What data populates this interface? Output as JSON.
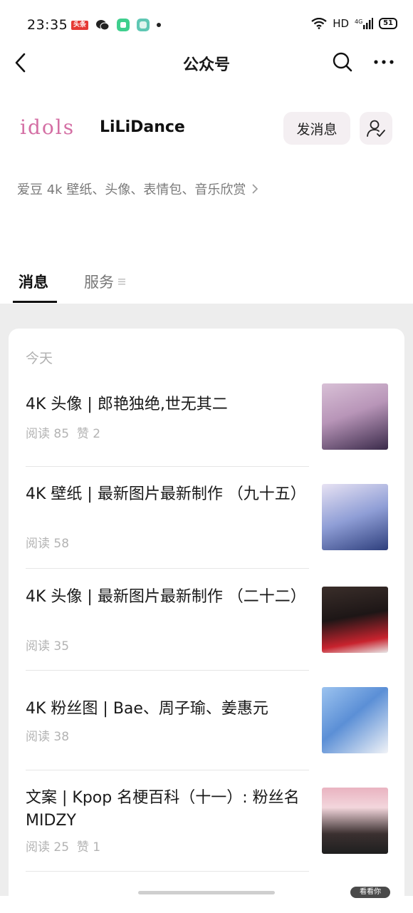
{
  "status_bar": {
    "time": "23:35",
    "toutiao_badge": "头条",
    "network": "HD",
    "signal_label": "4G",
    "battery": "51"
  },
  "nav": {
    "title": "公众号"
  },
  "account": {
    "logo_text": "idols",
    "name": "LiLiDance",
    "message_button": "发消息",
    "description": "爱豆 4k 壁纸、头像、表情包、音乐欣赏"
  },
  "tabs": [
    {
      "label": "消息",
      "active": true
    },
    {
      "label": "服务",
      "active": false
    }
  ],
  "feed": {
    "date_label": "今天",
    "articles": [
      {
        "title": "4K 头像 | 郎艳独绝,世无其二",
        "reads": "阅读 85",
        "likes": "赞 2",
        "thumb_colors": [
          "#c9a9c9",
          "#3a2a4a"
        ]
      },
      {
        "title": "4K 壁纸 | 最新图片最新制作 （九十五）",
        "reads": "阅读 58",
        "likes": "",
        "thumb_colors": [
          "#5b6fb4",
          "#e7e2f3"
        ]
      },
      {
        "title": "4K 头像 | 最新图片最新制作 （二十二）",
        "reads": "阅读 35",
        "likes": "",
        "thumb_colors": [
          "#2b2020",
          "#c8232e"
        ]
      },
      {
        "title": "4K 粉丝图 | Bae、周子瑜、姜惠元",
        "reads": "阅读 38",
        "likes": "",
        "thumb_colors": [
          "#5b8fd6",
          "#e9eef6"
        ]
      },
      {
        "title": "文案 | Kpop 名梗百科（十一）: 粉丝名 MIDZY",
        "reads": "阅读 25",
        "likes": "赞 1",
        "thumb_colors": [
          "#e2a9b7",
          "#2b2b2b"
        ]
      }
    ]
  },
  "corner_pill": "看看你"
}
